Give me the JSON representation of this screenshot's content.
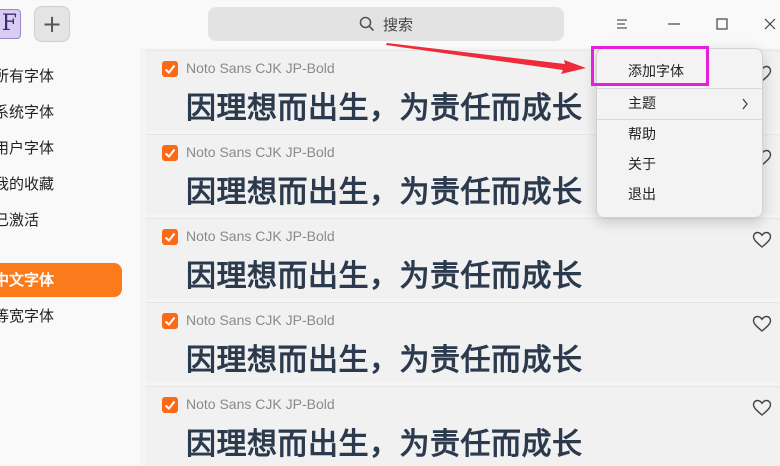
{
  "toolbar": {
    "app_icon_letter": "F",
    "add_label": "+",
    "search_placeholder": "搜索"
  },
  "sidebar": {
    "items": [
      {
        "label": "所有字体"
      },
      {
        "label": "系统字体"
      },
      {
        "label": "用户字体"
      },
      {
        "label": "我的收藏"
      },
      {
        "label": "已激活"
      },
      {
        "label": "中文字体",
        "active": true
      },
      {
        "label": "等宽字体"
      }
    ]
  },
  "fonts": [
    {
      "name": "Noto Sans CJK JP-Bold",
      "preview": "因理想而出生，为责任而成长",
      "enabled": true
    },
    {
      "name": "Noto Sans CJK JP-Bold",
      "preview": "因理想而出生，为责任而成长",
      "enabled": true
    },
    {
      "name": "Noto Sans CJK JP-Bold",
      "preview": "因理想而出生，为责任而成长",
      "enabled": true
    },
    {
      "name": "Noto Sans CJK JP-Bold",
      "preview": "因理想而出生，为责任而成长",
      "enabled": true
    },
    {
      "name": "Noto Sans CJK JP-Bold",
      "preview": "因理想而出生，为责任而成长",
      "enabled": true
    }
  ],
  "menu": {
    "items": [
      {
        "label": "添加字体"
      },
      {
        "label": "主题",
        "has_submenu": true
      },
      {
        "label": "帮助"
      },
      {
        "label": "关于"
      },
      {
        "label": "退出"
      }
    ]
  },
  "colors": {
    "accent": "#fb7a1c",
    "highlight": "#e81fd8",
    "arrow": "#ee2b3b"
  }
}
